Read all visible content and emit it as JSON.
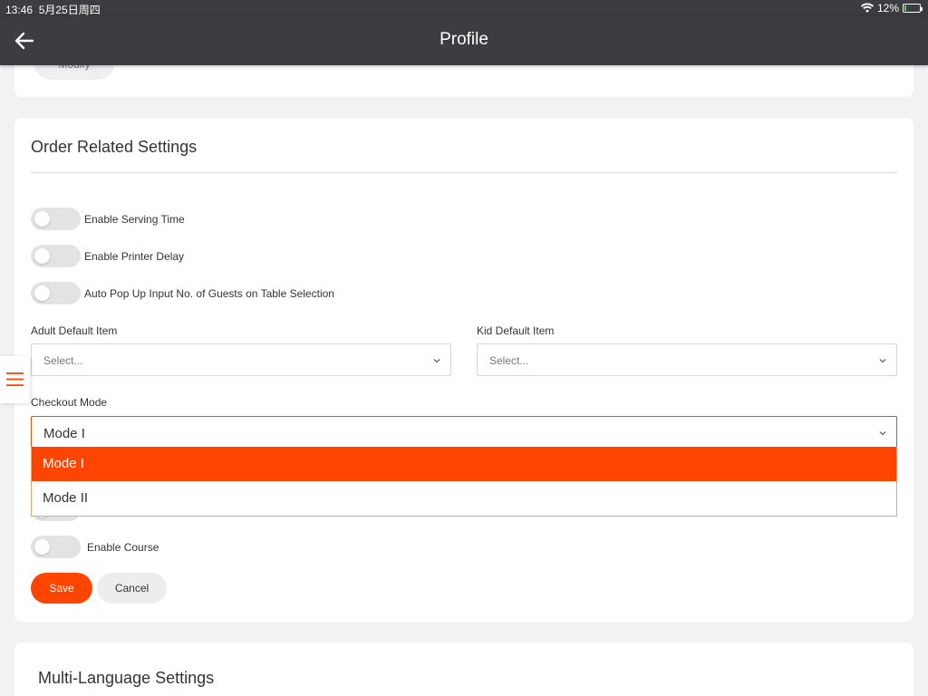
{
  "status_bar": {
    "time": "13:46",
    "date": "5月25日周四",
    "battery": "12%",
    "battery_level": 0.12
  },
  "header": {
    "title": "Profile",
    "back_icon": "arrow-left-icon"
  },
  "top_card": {
    "modify_label": "Modify"
  },
  "order_settings": {
    "title": "Order Related Settings",
    "toggles": [
      {
        "label": "Enable Serving Time",
        "on": false
      },
      {
        "label": "Enable Printer Delay",
        "on": false
      },
      {
        "label": "Auto Pop Up Input No. of Guests on Table Selection",
        "on": false
      }
    ],
    "adult_default_item": {
      "label": "Adult Default Item",
      "placeholder": "Select..."
    },
    "kid_default_item": {
      "label": "Kid Default Item",
      "placeholder": "Select..."
    },
    "checkout_mode": {
      "label": "Checkout Mode",
      "value": "Mode I",
      "options": [
        "Mode I",
        "Mode II"
      ]
    },
    "enable_course_label": "Enable Course",
    "save_label": "Save",
    "cancel_label": "Cancel"
  },
  "multi_language": {
    "title": "Multi-Language Settings"
  },
  "colors": {
    "accent": "#ff4500",
    "nav_background": "#3b3d41"
  }
}
